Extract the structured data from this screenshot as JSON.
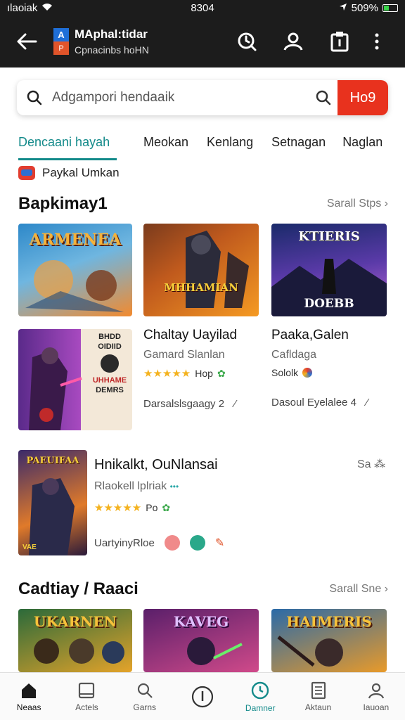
{
  "status": {
    "carrier": "ılaoiak",
    "time": "8304",
    "battery": "509%"
  },
  "app_bar": {
    "title": "MAphal:tidar",
    "subtitle": "Cpnacinbs hoHN",
    "logo_top": "A",
    "logo_bottom": "P"
  },
  "search": {
    "placeholder": "Adgampori hendaaik",
    "go_label": "Ho9"
  },
  "tabs": [
    {
      "label": "Dencaani hayah",
      "active": true
    },
    {
      "label": "Meokan",
      "active": false
    },
    {
      "label": "Kenlang",
      "active": false
    },
    {
      "label": "Setnagan",
      "active": false
    },
    {
      "label": "Naglan",
      "active": false
    }
  ],
  "category": {
    "label": "Paykal Umkan"
  },
  "section1": {
    "title": "Bapkimay1",
    "see_all": "Sarall Stps",
    "tiles": [
      {
        "label": "ARMENEA",
        "colors": [
          "#2d88c9",
          "#f28a2e"
        ]
      },
      {
        "label": "MHHAMIAN",
        "colors": [
          "#7a3b1d",
          "#f59a23"
        ]
      },
      {
        "label": "DOEBB",
        "colors": [
          "#2a3a7a",
          "#8a4fd0"
        ]
      }
    ]
  },
  "games_row": {
    "poster": {
      "line1": "BHDD",
      "line2": "OIDIID",
      "line3": "UHHAME",
      "line4": "DEMRS"
    },
    "cards": [
      {
        "name": "Chaltay Uayilad",
        "dev": "Gamard Slanlan",
        "rating_text": "Hop",
        "stars": "★★★★★",
        "meta": "Darsalslsgaagy 2"
      },
      {
        "name": "Paaka,Galen",
        "dev": "Cafldaga",
        "rating_text": "Sololk",
        "stars": "",
        "meta": "Dasoul Eyelalee 4"
      }
    ]
  },
  "featured": {
    "name": "Hnikalkt, OuNlansai",
    "dev": "Rlaokell lplriak",
    "stars": "★★★★★",
    "rating_text": "Po",
    "meta": "UartyinyRloe",
    "side": "Sa ⁂",
    "cover_label": "PAEUIFAA",
    "cover_badge": "VAE"
  },
  "section2": {
    "title": "Cadtiay / Raaci",
    "see_all": "Sarall Sne",
    "tiles": [
      {
        "label": "UKARNEN",
        "colors": [
          "#2b6a3a",
          "#e4a32a"
        ]
      },
      {
        "label": "KAVEG",
        "colors": [
          "#5a1f6a",
          "#d04a8a"
        ]
      },
      {
        "label": "HAIMERIS",
        "colors": [
          "#2a6aa8",
          "#e89a2a"
        ]
      }
    ]
  },
  "bottom_nav": [
    {
      "label": "Neaas",
      "icon": "home-icon",
      "active": true
    },
    {
      "label": "Actels",
      "icon": "tablet-icon",
      "active": false
    },
    {
      "label": "Garns",
      "icon": "search-icon",
      "active": false
    },
    {
      "label": "",
      "icon": "compass-icon",
      "active": false
    },
    {
      "label": "Damner",
      "icon": "clock-icon",
      "active": false,
      "teal": true
    },
    {
      "label": "Aktaun",
      "icon": "document-icon",
      "active": false
    },
    {
      "label": "Iauoan",
      "icon": "profile-icon",
      "active": false
    }
  ]
}
